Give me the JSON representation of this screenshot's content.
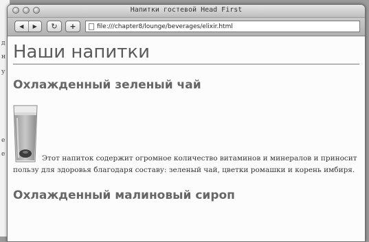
{
  "window": {
    "title": "Напитки гостевой Head First"
  },
  "toolbar": {
    "back_glyph": "◀",
    "forward_glyph": "▶",
    "reload_glyph": "↻",
    "add_glyph": "+",
    "address": "file:///chapter8/lounge/beverages/elixir.html",
    "icons": [
      "back-icon",
      "forward-icon",
      "reload-icon",
      "add-bookmark-icon",
      "page-icon"
    ]
  },
  "page": {
    "heading": "Наши напитки",
    "items": [
      {
        "name": "Охлажденный зеленый чай",
        "description": "Этот напиток содержит огромное количество витаминов и минералов и приносит пользу для здоровья благодаря составу: зеленый чай, цветки ромашки и корень имбиря."
      },
      {
        "name": "Охлажденный малиновый сироп"
      }
    ]
  },
  "background_fragment": {
    "glyphs": [
      "д",
      "н",
      "у",
      "е",
      "е"
    ]
  }
}
